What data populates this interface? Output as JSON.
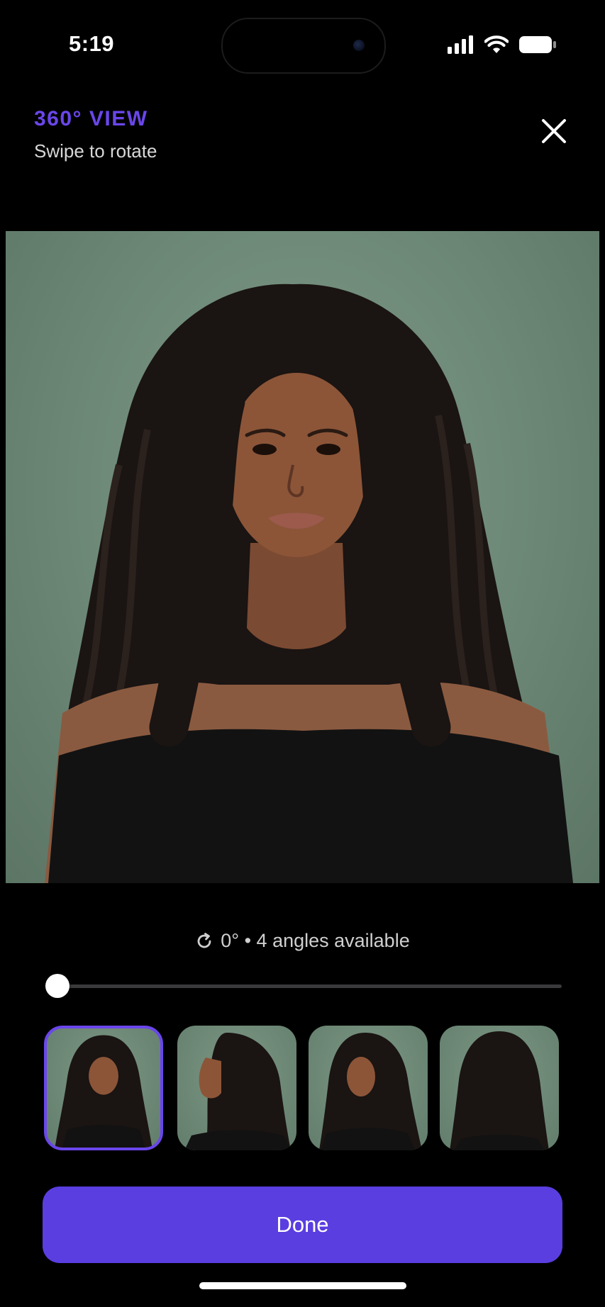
{
  "status_bar": {
    "time": "5:19"
  },
  "header": {
    "eyebrow": "360° VIEW",
    "subtitle": "Swipe to rotate"
  },
  "viewer": {
    "angle_text": "0° • 4 angles available",
    "rotation_fraction": 0
  },
  "thumbnails": [
    {
      "view": "front",
      "selected": true
    },
    {
      "view": "left-profile",
      "selected": false
    },
    {
      "view": "three-quarter",
      "selected": false
    },
    {
      "view": "back",
      "selected": false
    }
  ],
  "done_button": {
    "label": "Done"
  },
  "colors": {
    "accent": "#6a46ea",
    "button": "#5a3ee0",
    "backdrop": "#6c8776"
  },
  "icons": {
    "close": "close-icon",
    "rotate": "rotate-icon",
    "signal": "cellular-signal-icon",
    "wifi": "wifi-icon",
    "battery": "battery-icon"
  }
}
